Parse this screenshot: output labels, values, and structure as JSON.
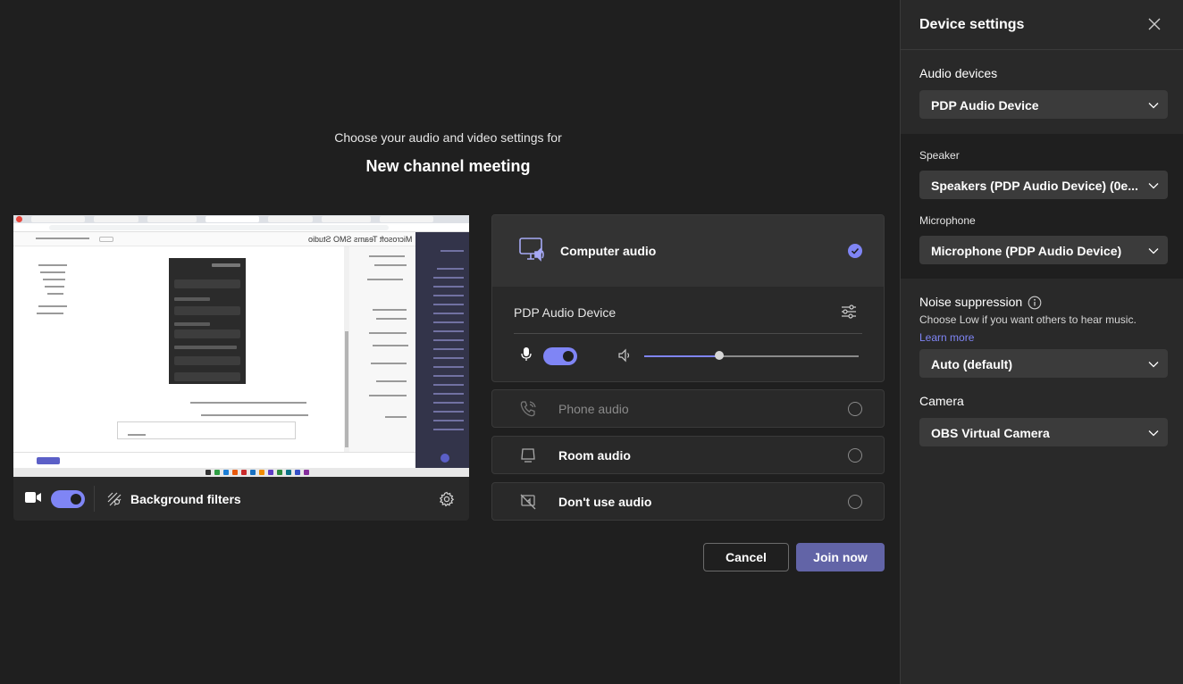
{
  "prejoin": {
    "subtitle": "Choose your audio and video settings for",
    "meeting_title": "New channel meeting",
    "preview_window_title": "Microsoft Teams SMO Studio"
  },
  "video_bar": {
    "camera_on": true,
    "background_filters_label": "Background filters"
  },
  "audio": {
    "computer_audio_label": "Computer audio",
    "computer_audio_selected": true,
    "device_name": "PDP Audio Device",
    "mic_on": true,
    "speaker_volume": 0.35,
    "options": [
      {
        "label": "Phone audio",
        "disabled": true,
        "icon": "phone-icon"
      },
      {
        "label": "Room audio",
        "disabled": false,
        "icon": "room-icon"
      },
      {
        "label": "Don't use audio",
        "disabled": false,
        "icon": "no-audio-icon"
      }
    ]
  },
  "actions": {
    "cancel_label": "Cancel",
    "join_label": "Join now"
  },
  "panel": {
    "title": "Device settings",
    "audio_devices_label": "Audio devices",
    "audio_devices_value": "PDP Audio Device",
    "speaker_label": "Speaker",
    "speaker_value": "Speakers (PDP Audio Device) (0e...",
    "microphone_label": "Microphone",
    "microphone_value": "Microphone (PDP Audio Device)",
    "noise_label": "Noise suppression",
    "noise_hint": "Choose Low if you want others to hear music.",
    "learn_more": "Learn more",
    "noise_value": "Auto (default)",
    "camera_label": "Camera",
    "camera_value": "OBS Virtual Camera"
  },
  "colors": {
    "accent": "#7f85f5",
    "join_button": "#6264a7",
    "background": "#1f1f1f",
    "panel": "#292929"
  }
}
